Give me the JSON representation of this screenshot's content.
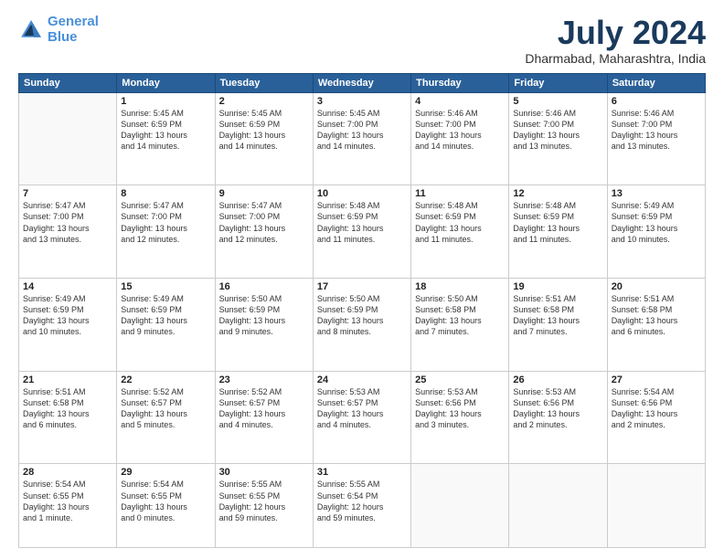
{
  "logo": {
    "line1": "General",
    "line2": "Blue"
  },
  "title": "July 2024",
  "location": "Dharmabad, Maharashtra, India",
  "days_of_week": [
    "Sunday",
    "Monday",
    "Tuesday",
    "Wednesday",
    "Thursday",
    "Friday",
    "Saturday"
  ],
  "weeks": [
    [
      {
        "day": "",
        "info": ""
      },
      {
        "day": "1",
        "info": "Sunrise: 5:45 AM\nSunset: 6:59 PM\nDaylight: 13 hours\nand 14 minutes."
      },
      {
        "day": "2",
        "info": "Sunrise: 5:45 AM\nSunset: 6:59 PM\nDaylight: 13 hours\nand 14 minutes."
      },
      {
        "day": "3",
        "info": "Sunrise: 5:45 AM\nSunset: 7:00 PM\nDaylight: 13 hours\nand 14 minutes."
      },
      {
        "day": "4",
        "info": "Sunrise: 5:46 AM\nSunset: 7:00 PM\nDaylight: 13 hours\nand 14 minutes."
      },
      {
        "day": "5",
        "info": "Sunrise: 5:46 AM\nSunset: 7:00 PM\nDaylight: 13 hours\nand 13 minutes."
      },
      {
        "day": "6",
        "info": "Sunrise: 5:46 AM\nSunset: 7:00 PM\nDaylight: 13 hours\nand 13 minutes."
      }
    ],
    [
      {
        "day": "7",
        "info": "Sunrise: 5:47 AM\nSunset: 7:00 PM\nDaylight: 13 hours\nand 13 minutes."
      },
      {
        "day": "8",
        "info": "Sunrise: 5:47 AM\nSunset: 7:00 PM\nDaylight: 13 hours\nand 12 minutes."
      },
      {
        "day": "9",
        "info": "Sunrise: 5:47 AM\nSunset: 7:00 PM\nDaylight: 13 hours\nand 12 minutes."
      },
      {
        "day": "10",
        "info": "Sunrise: 5:48 AM\nSunset: 6:59 PM\nDaylight: 13 hours\nand 11 minutes."
      },
      {
        "day": "11",
        "info": "Sunrise: 5:48 AM\nSunset: 6:59 PM\nDaylight: 13 hours\nand 11 minutes."
      },
      {
        "day": "12",
        "info": "Sunrise: 5:48 AM\nSunset: 6:59 PM\nDaylight: 13 hours\nand 11 minutes."
      },
      {
        "day": "13",
        "info": "Sunrise: 5:49 AM\nSunset: 6:59 PM\nDaylight: 13 hours\nand 10 minutes."
      }
    ],
    [
      {
        "day": "14",
        "info": "Sunrise: 5:49 AM\nSunset: 6:59 PM\nDaylight: 13 hours\nand 10 minutes."
      },
      {
        "day": "15",
        "info": "Sunrise: 5:49 AM\nSunset: 6:59 PM\nDaylight: 13 hours\nand 9 minutes."
      },
      {
        "day": "16",
        "info": "Sunrise: 5:50 AM\nSunset: 6:59 PM\nDaylight: 13 hours\nand 9 minutes."
      },
      {
        "day": "17",
        "info": "Sunrise: 5:50 AM\nSunset: 6:59 PM\nDaylight: 13 hours\nand 8 minutes."
      },
      {
        "day": "18",
        "info": "Sunrise: 5:50 AM\nSunset: 6:58 PM\nDaylight: 13 hours\nand 7 minutes."
      },
      {
        "day": "19",
        "info": "Sunrise: 5:51 AM\nSunset: 6:58 PM\nDaylight: 13 hours\nand 7 minutes."
      },
      {
        "day": "20",
        "info": "Sunrise: 5:51 AM\nSunset: 6:58 PM\nDaylight: 13 hours\nand 6 minutes."
      }
    ],
    [
      {
        "day": "21",
        "info": "Sunrise: 5:51 AM\nSunset: 6:58 PM\nDaylight: 13 hours\nand 6 minutes."
      },
      {
        "day": "22",
        "info": "Sunrise: 5:52 AM\nSunset: 6:57 PM\nDaylight: 13 hours\nand 5 minutes."
      },
      {
        "day": "23",
        "info": "Sunrise: 5:52 AM\nSunset: 6:57 PM\nDaylight: 13 hours\nand 4 minutes."
      },
      {
        "day": "24",
        "info": "Sunrise: 5:53 AM\nSunset: 6:57 PM\nDaylight: 13 hours\nand 4 minutes."
      },
      {
        "day": "25",
        "info": "Sunrise: 5:53 AM\nSunset: 6:56 PM\nDaylight: 13 hours\nand 3 minutes."
      },
      {
        "day": "26",
        "info": "Sunrise: 5:53 AM\nSunset: 6:56 PM\nDaylight: 13 hours\nand 2 minutes."
      },
      {
        "day": "27",
        "info": "Sunrise: 5:54 AM\nSunset: 6:56 PM\nDaylight: 13 hours\nand 2 minutes."
      }
    ],
    [
      {
        "day": "28",
        "info": "Sunrise: 5:54 AM\nSunset: 6:55 PM\nDaylight: 13 hours\nand 1 minute."
      },
      {
        "day": "29",
        "info": "Sunrise: 5:54 AM\nSunset: 6:55 PM\nDaylight: 13 hours\nand 0 minutes."
      },
      {
        "day": "30",
        "info": "Sunrise: 5:55 AM\nSunset: 6:55 PM\nDaylight: 12 hours\nand 59 minutes."
      },
      {
        "day": "31",
        "info": "Sunrise: 5:55 AM\nSunset: 6:54 PM\nDaylight: 12 hours\nand 59 minutes."
      },
      {
        "day": "",
        "info": ""
      },
      {
        "day": "",
        "info": ""
      },
      {
        "day": "",
        "info": ""
      }
    ]
  ]
}
